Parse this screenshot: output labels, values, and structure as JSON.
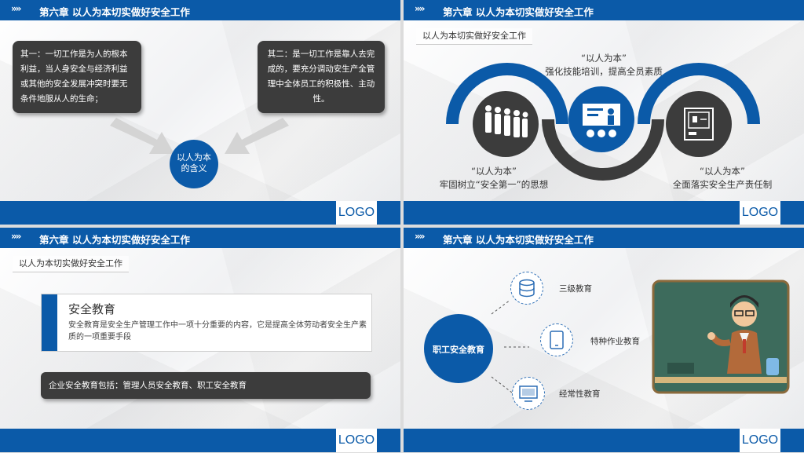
{
  "header_title": "第六章 以人为本切实做好安全工作",
  "chevrons": "»»",
  "logo": "LOGO",
  "subtitle": "以人为本切实做好安全工作",
  "slide1": {
    "box_left": "其一：一切工作是为人的根本利益，当人身安全与经济利益或其他的安全发展冲突时要无条件地服从人的生命；",
    "box_right": "其二：是一切工作是靠人去完成的，要充分调动安生产全管理中全体员工的积极性、主动性。",
    "center_label": "以人为本的含义"
  },
  "slide2": {
    "top_quote": "“以人为本”",
    "top_text": "强化技能培训，提高全员素质",
    "left_quote": "“以人为本”",
    "left_text": "牢固树立“安全第一”的思想",
    "right_quote": "“以人为本”",
    "right_text": "全面落实安全生产责任制",
    "icons": [
      "queue-people-icon",
      "teacher-board-icon",
      "machine-icon"
    ]
  },
  "slide3": {
    "card_title": "安全教育",
    "card_text": "安全教育是安全生产管理工作中一项十分重要的内容，它是提高全体劳动者安全生产素质的一项重要手段",
    "bar_text": "企业安全教育包括：管理人员安全教育、职工安全教育"
  },
  "slide4": {
    "center_label": "职工安全教育",
    "items": [
      "三级教育",
      "特种作业教育",
      "经常性教育"
    ],
    "icons": [
      "database-icon",
      "tablet-icon",
      "monitor-icon"
    ]
  },
  "colors": {
    "primary": "#0b5aa8",
    "dark": "#3c3c3c"
  }
}
